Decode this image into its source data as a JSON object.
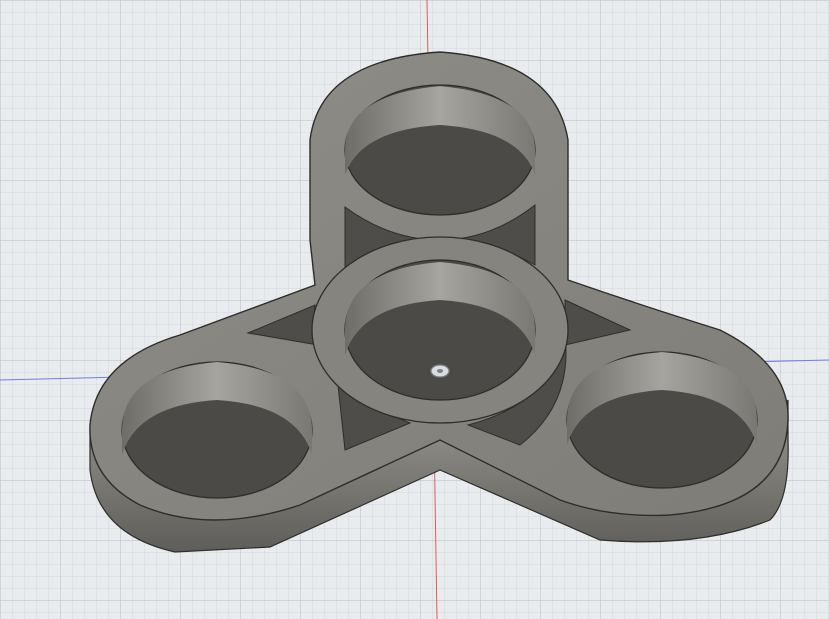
{
  "viewport": {
    "background": "#e9ecef",
    "grid": {
      "minor_color": "#d3d7db",
      "major_color": "#bfc4c9"
    },
    "axes": {
      "vertical_axis_color": "#e15a5a",
      "horizontal_axis_color": "#6f7fe0"
    },
    "origin_marker": "origin-icon"
  },
  "model": {
    "object": "fidget-spinner",
    "lobes": 3,
    "bearing_holes": 4,
    "body_color": "#8a8881",
    "top_face_color": "#92908a",
    "side_color": "#6b6964",
    "hole_wall_color": "#a09e98",
    "edge_color": "#2e2d2a"
  }
}
